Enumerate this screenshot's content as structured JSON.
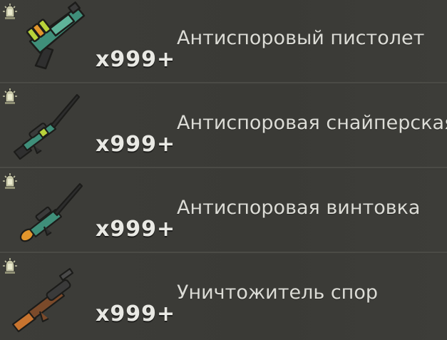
{
  "items": [
    {
      "name": "Антиспоровый пистолет",
      "quantity": "x999+",
      "weapon_icon": "antispore-pistol-icon",
      "badge_icon": "spore-badge-icon"
    },
    {
      "name": "Антиспоровая снайперская",
      "quantity": "x999+",
      "weapon_icon": "antispore-sniper-icon",
      "badge_icon": "spore-badge-icon"
    },
    {
      "name": "Антиспоровая винтовка",
      "quantity": "x999+",
      "weapon_icon": "antispore-rifle-icon",
      "badge_icon": "spore-badge-icon"
    },
    {
      "name": "Уничтожитель спор",
      "quantity": "x999+",
      "weapon_icon": "spore-destroyer-icon",
      "badge_icon": "spore-badge-icon"
    }
  ],
  "colors": {
    "background": "#3b3b37",
    "text": "#dcdcd6",
    "quantity_text": "#e9e9e4",
    "weapon_teal": "#3f8f7a",
    "accent_green": "#b8d23a",
    "accent_orange": "#e2962c"
  }
}
